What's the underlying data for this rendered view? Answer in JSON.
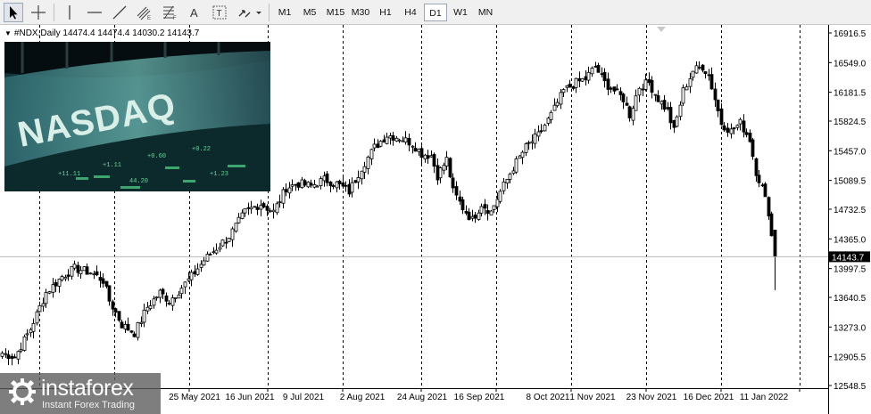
{
  "toolbar": {
    "tools": [
      {
        "name": "cursor-icon",
        "label": "Cursor"
      },
      {
        "name": "crosshair-icon",
        "label": "Crosshair"
      },
      {
        "name": "vertical-line-icon",
        "label": "Vertical Line"
      },
      {
        "name": "horizontal-line-icon",
        "label": "Horizontal Line"
      },
      {
        "name": "trendline-icon",
        "label": "Trendline"
      },
      {
        "name": "equidistant-channel-icon",
        "label": "Equidistant Channel"
      },
      {
        "name": "fibonacci-retracement-icon",
        "label": "Fibonacci Retracement"
      },
      {
        "name": "text-icon",
        "label": "Text"
      },
      {
        "name": "text-label-icon",
        "label": "Text Label"
      },
      {
        "name": "arrows-icon",
        "label": "Arrows"
      }
    ],
    "text_glyphs": {
      "text": "A",
      "label": "T"
    },
    "timeframes": [
      "M1",
      "M5",
      "M15",
      "M30",
      "H1",
      "H4",
      "D1",
      "W1",
      "MN"
    ],
    "active_timeframe": "D1"
  },
  "chart": {
    "symbol_info": "#NDX,Daily  14474.4 14474.4 14030.2 14143.7",
    "current_price_label": "14143.7",
    "colors": {
      "grid": "#000000",
      "candle": "#000000",
      "price_tag_bg": "#000000",
      "price_tag_text": "#ffffff"
    }
  },
  "chart_data": {
    "type": "candlestick",
    "symbol": "#NDX",
    "timeframe": "Daily",
    "ohlc_last": {
      "open": 14474.4,
      "high": 14474.4,
      "low": 14030.2,
      "close": 14143.7
    },
    "current_price": 14143.7,
    "y_ticks": [
      16916.5,
      16549.0,
      16181.5,
      15824.5,
      15457.0,
      15089.5,
      14732.5,
      14365.0,
      13997.5,
      13640.5,
      13273.0,
      12905.5,
      12548.5
    ],
    "x_ticks": [
      "25 May 2021",
      "16 Jun 2021",
      "9 Jul 2021",
      "2 Aug 2021",
      "24 Aug 2021",
      "16 Sep 2021",
      "8 Oct 2021",
      "1 Nov 2021",
      "23 Nov 2021",
      "16 Dec 2021",
      "11 Jan 2022"
    ],
    "ylim": [
      12548.5,
      16916.5
    ],
    "grid": "vertical dashed",
    "anchors": [
      {
        "i": 0,
        "v": 12950
      },
      {
        "i": 4,
        "v": 12900
      },
      {
        "i": 9,
        "v": 13250
      },
      {
        "i": 14,
        "v": 13700
      },
      {
        "i": 19,
        "v": 13900
      },
      {
        "i": 23,
        "v": 14000
      },
      {
        "i": 28,
        "v": 13950
      },
      {
        "i": 32,
        "v": 13850
      },
      {
        "i": 34,
        "v": 13600
      },
      {
        "i": 38,
        "v": 13300
      },
      {
        "i": 42,
        "v": 13200
      },
      {
        "i": 46,
        "v": 13520
      },
      {
        "i": 50,
        "v": 13700
      },
      {
        "i": 53,
        "v": 13600
      },
      {
        "i": 56,
        "v": 13720
      },
      {
        "i": 60,
        "v": 13900
      },
      {
        "i": 64,
        "v": 14100
      },
      {
        "i": 68,
        "v": 14250
      },
      {
        "i": 72,
        "v": 14400
      },
      {
        "i": 77,
        "v": 14700
      },
      {
        "i": 82,
        "v": 14800
      },
      {
        "i": 86,
        "v": 14700
      },
      {
        "i": 90,
        "v": 15000
      },
      {
        "i": 94,
        "v": 15050
      },
      {
        "i": 98,
        "v": 15020
      },
      {
        "i": 102,
        "v": 15100
      },
      {
        "i": 106,
        "v": 15050
      },
      {
        "i": 110,
        "v": 14950
      },
      {
        "i": 114,
        "v": 15250
      },
      {
        "i": 118,
        "v": 15500
      },
      {
        "i": 122,
        "v": 15650
      },
      {
        "i": 126,
        "v": 15620
      },
      {
        "i": 130,
        "v": 15550
      },
      {
        "i": 133,
        "v": 15420
      },
      {
        "i": 136,
        "v": 15400
      },
      {
        "i": 138,
        "v": 15150
      },
      {
        "i": 141,
        "v": 15350
      },
      {
        "i": 143,
        "v": 14950
      },
      {
        "i": 146,
        "v": 14750
      },
      {
        "i": 149,
        "v": 14600
      },
      {
        "i": 152,
        "v": 14800
      },
      {
        "i": 155,
        "v": 14700
      },
      {
        "i": 158,
        "v": 14950
      },
      {
        "i": 162,
        "v": 15250
      },
      {
        "i": 166,
        "v": 15500
      },
      {
        "i": 170,
        "v": 15650
      },
      {
        "i": 174,
        "v": 15900
      },
      {
        "i": 178,
        "v": 16200
      },
      {
        "i": 182,
        "v": 16300
      },
      {
        "i": 185,
        "v": 16350
      },
      {
        "i": 188,
        "v": 16500
      },
      {
        "i": 191,
        "v": 16300
      },
      {
        "i": 194,
        "v": 16200
      },
      {
        "i": 197,
        "v": 16100
      },
      {
        "i": 199,
        "v": 15900
      },
      {
        "i": 202,
        "v": 16250
      },
      {
        "i": 205,
        "v": 16300
      },
      {
        "i": 208,
        "v": 16100
      },
      {
        "i": 211,
        "v": 15950
      },
      {
        "i": 213,
        "v": 15700
      },
      {
        "i": 216,
        "v": 16200
      },
      {
        "i": 219,
        "v": 16450
      },
      {
        "i": 222,
        "v": 16500
      },
      {
        "i": 224,
        "v": 16400
      },
      {
        "i": 226,
        "v": 16100
      },
      {
        "i": 228,
        "v": 15800
      },
      {
        "i": 231,
        "v": 15700
      },
      {
        "i": 234,
        "v": 15800
      },
      {
        "i": 237,
        "v": 15600
      },
      {
        "i": 239,
        "v": 15200
      },
      {
        "i": 241,
        "v": 15000
      },
      {
        "i": 243,
        "v": 14700
      },
      {
        "i": 244,
        "v": 14400
      },
      {
        "i": 245,
        "v": 14143.7
      }
    ]
  }
}
